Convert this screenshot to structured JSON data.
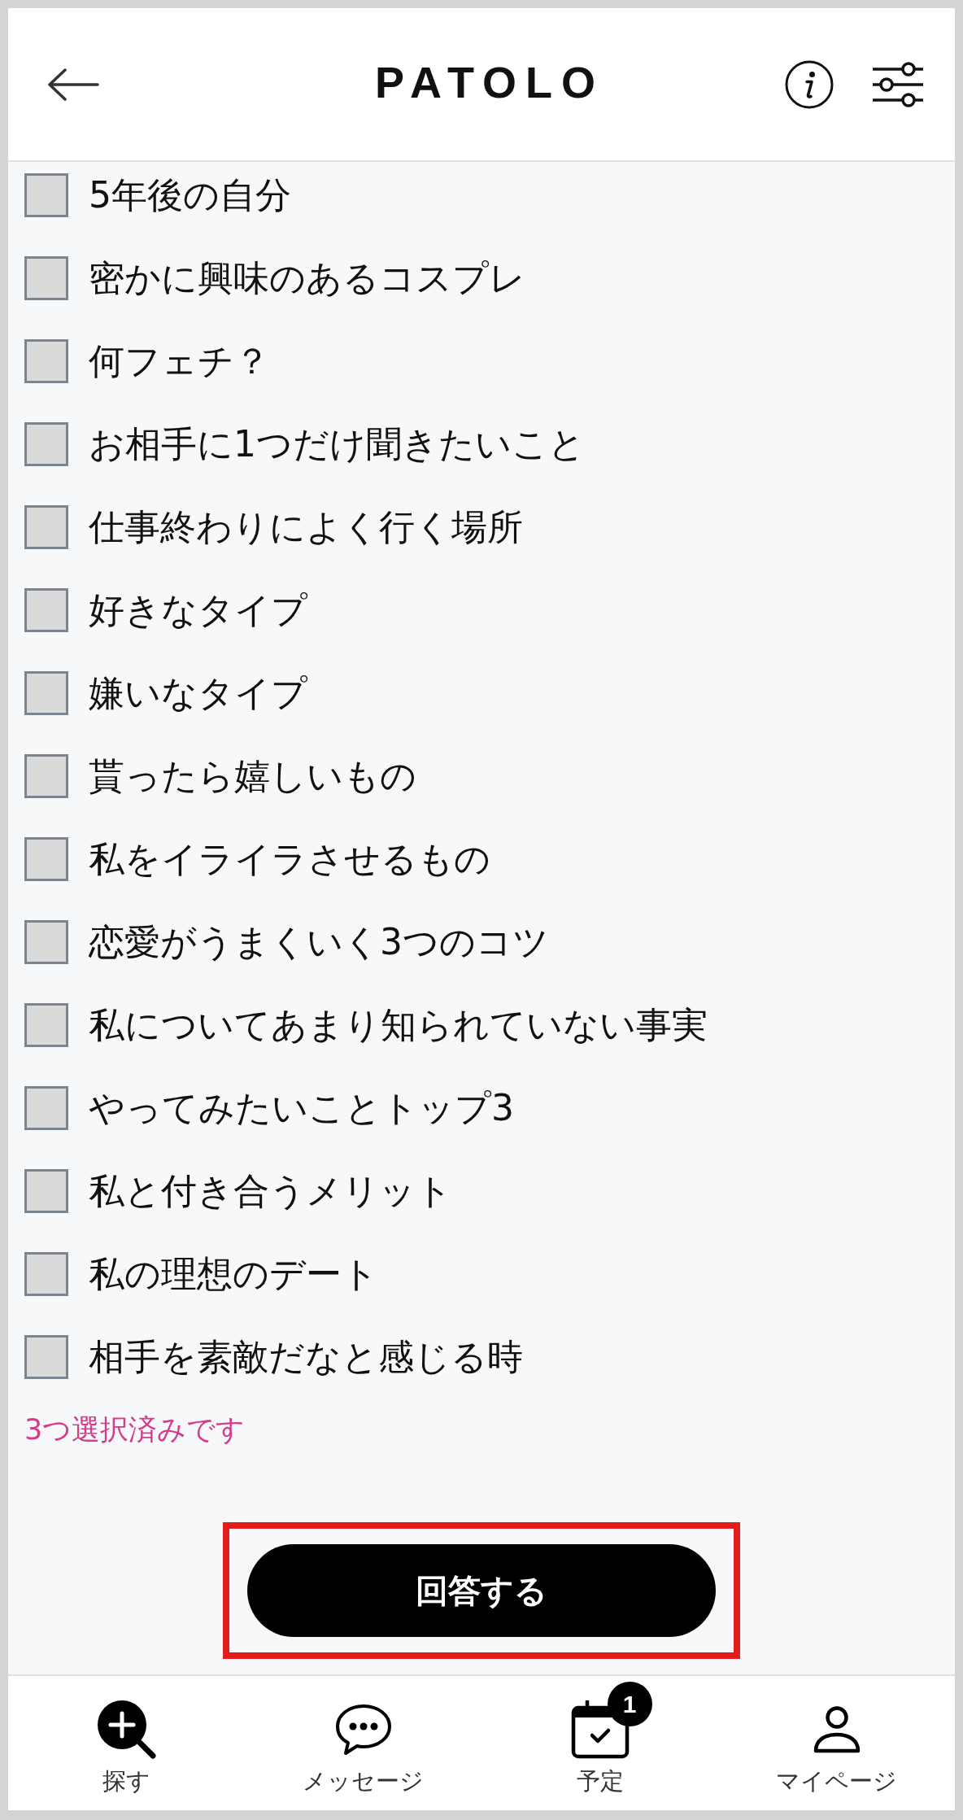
{
  "header": {
    "title": "PATOLO"
  },
  "questions": [
    {
      "label": "5年後の自分",
      "checked": false
    },
    {
      "label": "密かに興味のあるコスプレ",
      "checked": false
    },
    {
      "label": "何フェチ？",
      "checked": false
    },
    {
      "label": "お相手に1つだけ聞きたいこと",
      "checked": false
    },
    {
      "label": "仕事終わりによく行く場所",
      "checked": false
    },
    {
      "label": "好きなタイプ",
      "checked": false
    },
    {
      "label": "嫌いなタイプ",
      "checked": false
    },
    {
      "label": "貰ったら嬉しいもの",
      "checked": false
    },
    {
      "label": "私をイライラさせるもの",
      "checked": false
    },
    {
      "label": "恋愛がうまくいく3つのコツ",
      "checked": false
    },
    {
      "label": "私についてあまり知られていない事実",
      "checked": false
    },
    {
      "label": "やってみたいことトップ3",
      "checked": false
    },
    {
      "label": "私と付き合うメリット",
      "checked": false
    },
    {
      "label": "私の理想のデート",
      "checked": false
    },
    {
      "label": "相手を素敵だなと感じる時",
      "checked": false
    }
  ],
  "selection_status": "3つ選択済みです",
  "submit_button": {
    "label": "回答する",
    "highlighted": true
  },
  "bottom_nav": [
    {
      "label": "探す"
    },
    {
      "label": "メッセージ"
    },
    {
      "label": "予定",
      "badge": "1"
    },
    {
      "label": "マイページ"
    }
  ]
}
